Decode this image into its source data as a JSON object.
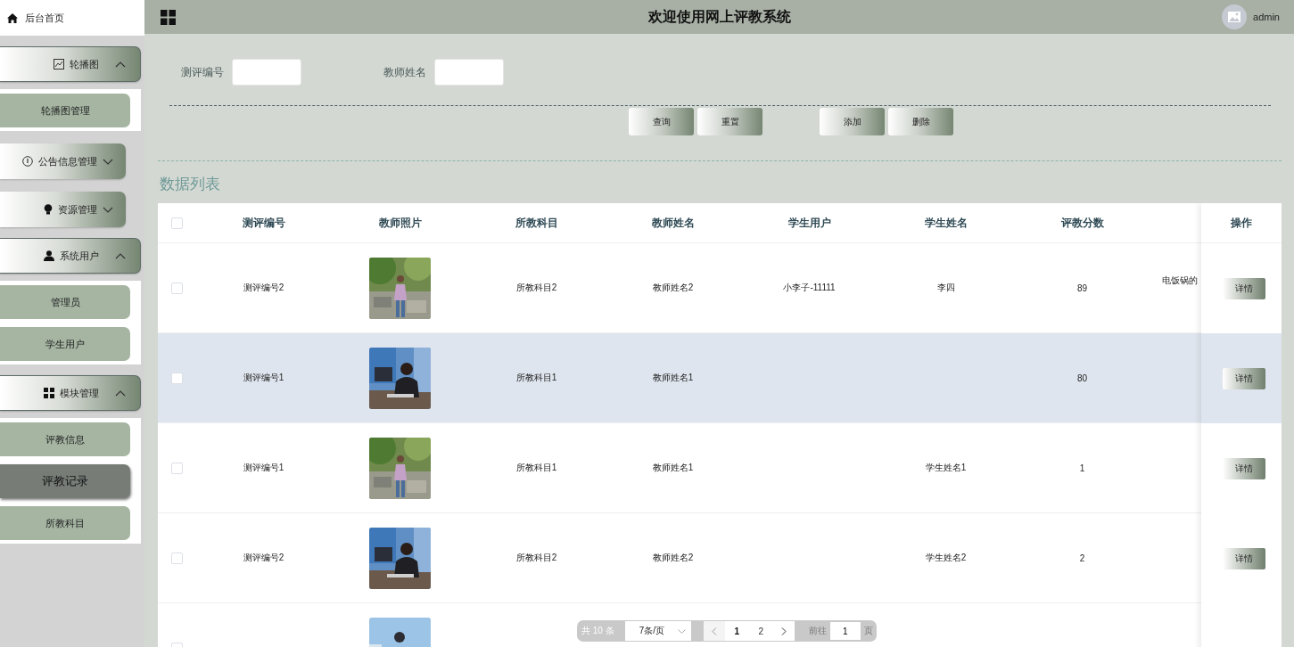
{
  "sidebar": {
    "home": "后台首页",
    "groups": [
      {
        "label": "轮播图",
        "expanded": true,
        "children": [
          {
            "label": "轮播图管理",
            "selected": false
          }
        ]
      },
      {
        "label": "公告信息管理",
        "expanded": false
      },
      {
        "label": "资源管理",
        "expanded": false
      },
      {
        "label": "系统用户",
        "expanded": true,
        "children": [
          {
            "label": "管理员",
            "selected": false
          },
          {
            "label": "学生用户",
            "selected": false
          }
        ]
      },
      {
        "label": "模块管理",
        "expanded": true,
        "children": [
          {
            "label": "评教信息",
            "selected": false
          },
          {
            "label": "评教记录",
            "selected": true
          },
          {
            "label": "所教科目",
            "selected": false
          }
        ]
      }
    ]
  },
  "header": {
    "title": "欢迎使用网上评教系统",
    "user": "admin"
  },
  "search": {
    "fields": [
      {
        "label": "测评编号"
      },
      {
        "label": "教师姓名"
      }
    ],
    "buttons": [
      "查询",
      "重置",
      "添加",
      "删除"
    ]
  },
  "section_title": "数据列表",
  "table": {
    "select_all_checked": false,
    "columns": [
      "测评编号",
      "教师照片",
      "所教科目",
      "教师姓名",
      "学生用户",
      "学生姓名",
      "评教分数"
    ],
    "action_column": "操作",
    "rows": [
      {
        "checked": false,
        "highlighted": false,
        "id": "测评编号2",
        "subject": "所教科目2",
        "teacher": "教师姓名2",
        "student_user": "小李子-11111",
        "student_name": "李四",
        "score": "89",
        "comment": "电饭锅的",
        "action": "详情"
      },
      {
        "checked": false,
        "highlighted": true,
        "id": "测评编号1",
        "subject": "所教科目1",
        "teacher": "教师姓名1",
        "score": "80",
        "action": "详情"
      },
      {
        "checked": false,
        "highlighted": false,
        "id": "测评编号1",
        "subject": "所教科目1",
        "teacher": "教师姓名1",
        "student_name": "学生姓名1",
        "score": "1",
        "action": "详情"
      },
      {
        "checked": false,
        "highlighted": false,
        "id": "测评编号2",
        "subject": "所教科目2",
        "teacher": "教师姓名2",
        "student_name": "学生姓名2",
        "score": "2",
        "action": "详情"
      },
      {
        "checked": false,
        "highlighted": false
      }
    ]
  },
  "pagination": {
    "total": "共 10 条",
    "page_size": "7条/页",
    "pages": [
      {
        "label": "1",
        "selected": true
      },
      {
        "label": "2",
        "selected": false
      }
    ],
    "goto_label": "前往",
    "goto_value": "1",
    "goto_suffix": "页"
  }
}
